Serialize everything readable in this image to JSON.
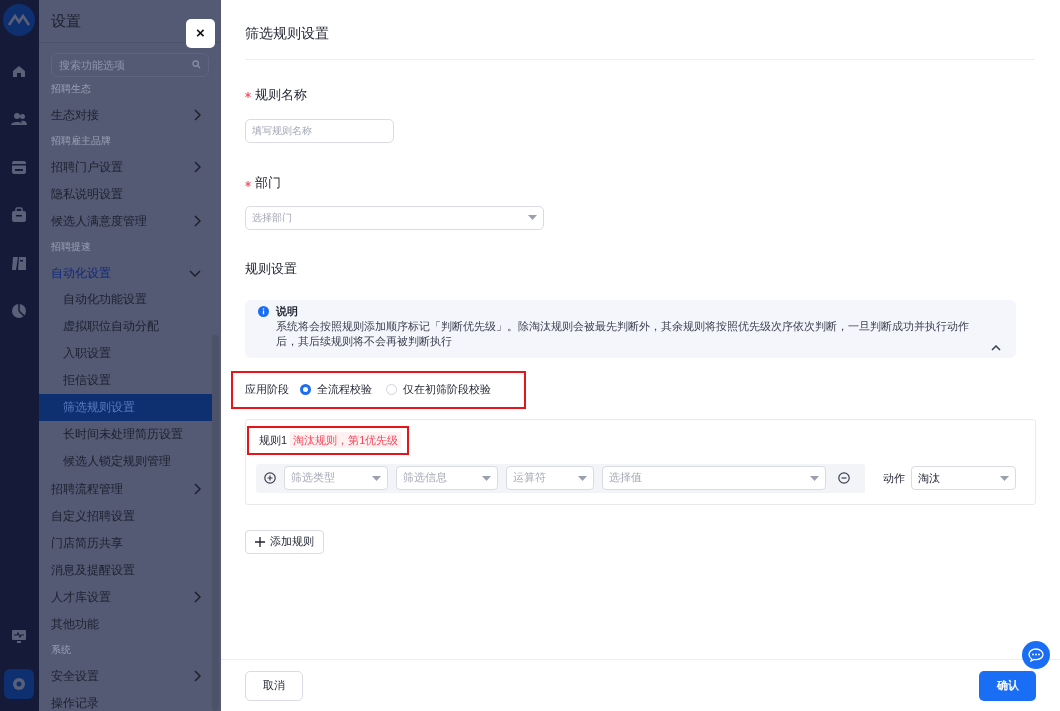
{
  "rail": {
    "items": [
      {
        "kind": "home",
        "selected": false
      },
      {
        "kind": "people",
        "selected": false
      },
      {
        "kind": "calendar",
        "selected": false
      },
      {
        "kind": "bag",
        "selected": false
      },
      {
        "kind": "book",
        "selected": false
      },
      {
        "kind": "pie",
        "selected": false
      },
      {
        "kind": "monitor",
        "selected": false
      },
      {
        "kind": "settings",
        "selected": true
      }
    ]
  },
  "settings_menu": {
    "title": "设置",
    "search": {
      "placeholder": "搜索功能选项"
    },
    "items": [
      {
        "kind": "group",
        "label": "招聘生态"
      },
      {
        "kind": "item",
        "label": "生态对接",
        "has_children": true,
        "expanded": false,
        "selected": false
      },
      {
        "kind": "group",
        "label": "招聘雇主品牌"
      },
      {
        "kind": "item",
        "label": "招聘门户设置",
        "has_children": true,
        "expanded": false,
        "selected": false
      },
      {
        "kind": "item",
        "label": "隐私说明设置",
        "has_children": false,
        "expanded": false,
        "selected": false
      },
      {
        "kind": "item",
        "label": "候选人满意度管理",
        "has_children": true,
        "expanded": false,
        "selected": false
      },
      {
        "kind": "group",
        "label": "招聘提速"
      },
      {
        "kind": "item",
        "label": "自动化设置",
        "has_children": true,
        "expanded": true,
        "selected": false,
        "children": [
          {
            "label": "自动化功能设置",
            "selected": false
          },
          {
            "label": "虚拟职位自动分配",
            "selected": false
          },
          {
            "label": "入职设置",
            "selected": false
          },
          {
            "label": "拒信设置",
            "selected": false
          },
          {
            "label": "筛选规则设置",
            "selected": true
          },
          {
            "label": "长时间未处理简历设置",
            "selected": false
          },
          {
            "label": "候选人锁定规则管理",
            "selected": false
          }
        ]
      },
      {
        "kind": "item",
        "label": "招聘流程管理",
        "has_children": true,
        "expanded": false,
        "selected": false
      },
      {
        "kind": "item",
        "label": "自定义招聘设置",
        "has_children": false,
        "expanded": false,
        "selected": false
      },
      {
        "kind": "item",
        "label": "门店简历共享",
        "has_children": false,
        "expanded": false,
        "selected": false
      },
      {
        "kind": "item",
        "label": "消息及提醒设置",
        "has_children": false,
        "expanded": false,
        "selected": false
      },
      {
        "kind": "item",
        "label": "人才库设置",
        "has_children": true,
        "expanded": false,
        "selected": false
      },
      {
        "kind": "item",
        "label": "其他功能",
        "has_children": false,
        "expanded": false,
        "selected": false
      },
      {
        "kind": "group",
        "label": "系统"
      },
      {
        "kind": "item",
        "label": "安全设置",
        "has_children": true,
        "expanded": false,
        "selected": false
      },
      {
        "kind": "item",
        "label": "操作记录",
        "has_children": false,
        "expanded": false,
        "selected": false
      }
    ]
  },
  "drawer": {
    "close": "×",
    "title": "筛选规则设置",
    "fields": [
      {
        "label": "规则名称",
        "required": true,
        "kind": "input",
        "placeholder": "填写规则名称"
      },
      {
        "label": "部门",
        "required": true,
        "kind": "select",
        "placeholder": "选择部门"
      }
    ],
    "section_title": "规则设置",
    "notice": {
      "title": "说明",
      "text": "系统将会按照规则添加顺序标记「判断优先级」。除淘汰规则会被最先判断外，其余规则将按照优先级次序依次判断，一旦判断成功并执行动作后，其后续规则将不会再被判断执行",
      "expanded": true
    },
    "stage": {
      "label": "应用阶段",
      "options": [
        {
          "label": "全流程校验",
          "selected": true
        },
        {
          "label": "仅在初筛阶段校验",
          "selected": false
        }
      ]
    },
    "rules": [
      {
        "name": "规则1",
        "tag": "淘汰规则，第1优先级",
        "conditions": [
          {
            "selects": [
              {
                "placeholder": "筛选类型"
              },
              {
                "placeholder": "筛选信息"
              },
              {
                "placeholder": "运算符"
              },
              {
                "placeholder": "选择值"
              }
            ]
          }
        ],
        "action_label": "动作",
        "action": "淘汰"
      }
    ],
    "add_rule": "添加规则",
    "buttons": [
      {
        "kind": "secondary",
        "label": "取消"
      },
      {
        "kind": "primary",
        "label": "确认"
      }
    ]
  }
}
